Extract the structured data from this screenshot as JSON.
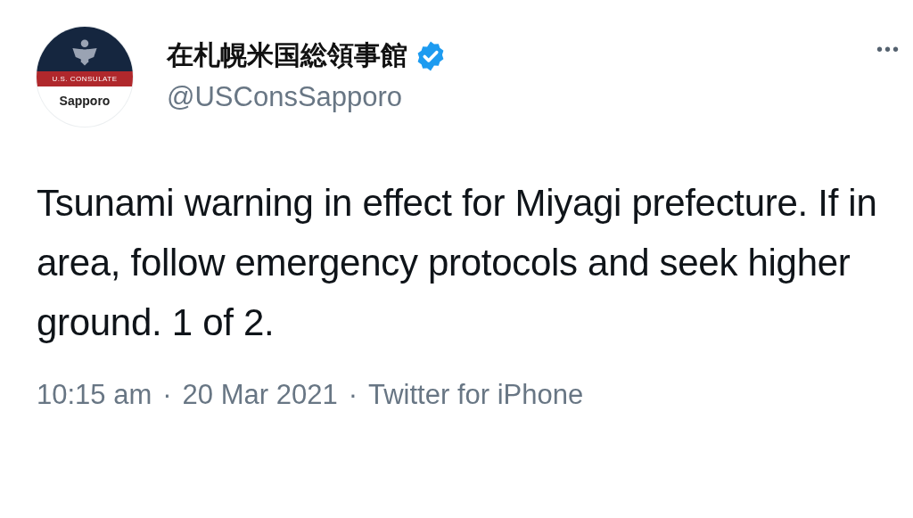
{
  "tweet": {
    "avatar": {
      "band": "U.S. CONSULATE",
      "caption": "Sapporo"
    },
    "author": {
      "name": "在札幌米国総領事館",
      "verified": true,
      "handle": "@USConsSapporo"
    },
    "more": "•••",
    "text": "Tsunami warning in effect for Miyagi prefecture. If in area, follow emergency protocols and seek higher ground. 1 of 2.",
    "meta": [
      {
        "text": "10:15 am"
      },
      {
        "text": "·"
      },
      {
        "text": "20 Mar 2021"
      },
      {
        "text": "·"
      },
      {
        "text": "Twitter for iPhone"
      }
    ]
  }
}
